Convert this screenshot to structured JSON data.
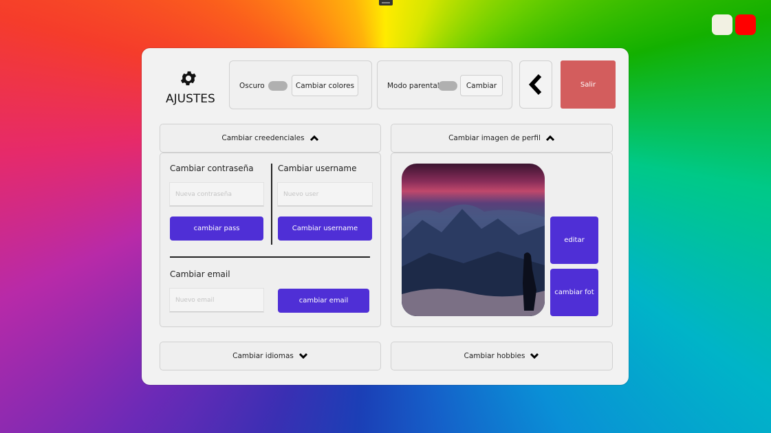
{
  "window": {
    "light_color": "#f2f1e3",
    "close_color": "#ff0000"
  },
  "settings": {
    "title": "AJUSTES",
    "icon": "gear-icon"
  },
  "theme": {
    "dark_label": "Oscuro",
    "change_colors_label": "Cambiar colores"
  },
  "parental": {
    "label": "Modo parental",
    "change_label": "Cambiar"
  },
  "nav": {
    "back_icon": "chevron-left-icon",
    "exit_label": "Salir",
    "exit_color": "#d35d5d"
  },
  "credentials": {
    "header": "Cambiar creedenciales",
    "password": {
      "heading": "Cambiar contraseña",
      "placeholder": "Nueva contraseña",
      "button": "cambiar pass"
    },
    "username": {
      "heading": "Cambiar username",
      "placeholder": "Nuevo user",
      "button": "Cambiar username"
    },
    "email": {
      "heading": "Cambiar email",
      "placeholder": "Nuevo email",
      "button": "cambiar email"
    }
  },
  "profile_image": {
    "header": "Cambiar imagen de perfil",
    "edit_label": "editar",
    "change_photo_label": "cambiar fot"
  },
  "languages": {
    "header": "Cambiar idiomas"
  },
  "hobbies": {
    "header": "Cambiar hobbies"
  },
  "accent_color": "#4f2fd6"
}
